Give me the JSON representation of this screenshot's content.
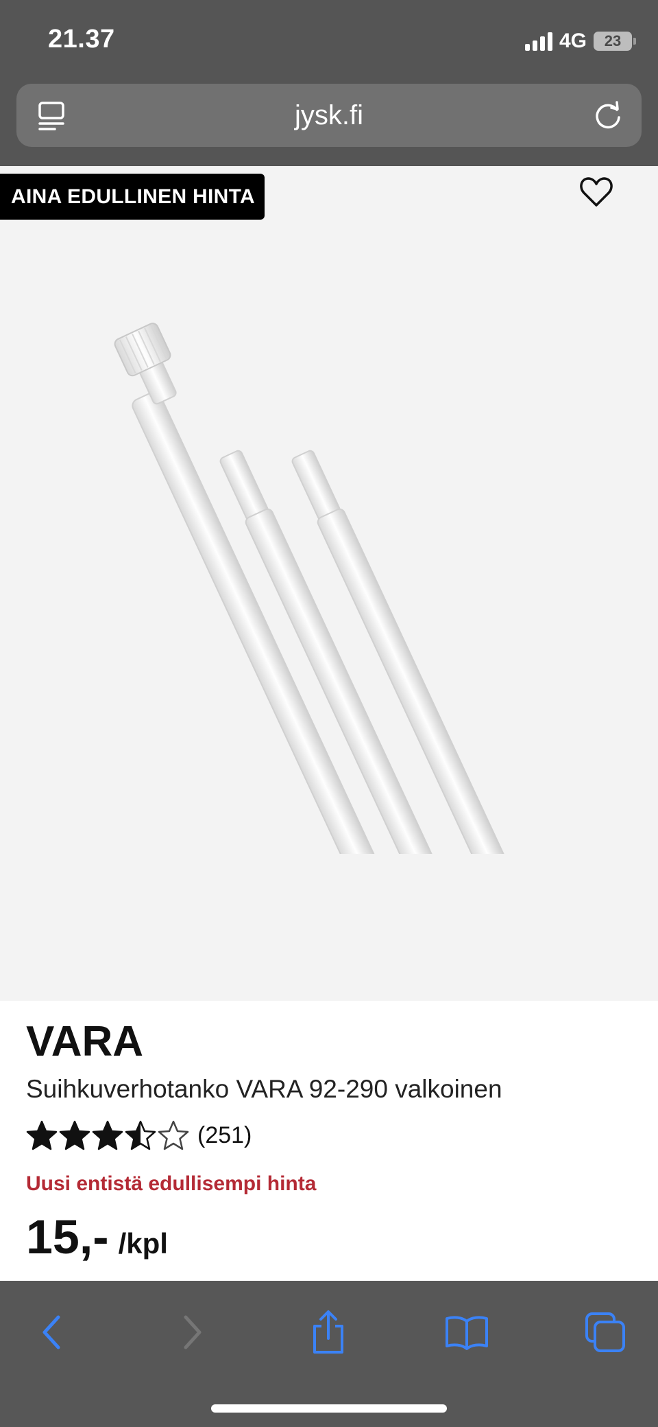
{
  "status_bar": {
    "time": "21.37",
    "network": "4G",
    "battery": "23"
  },
  "browser": {
    "url": "jysk.fi"
  },
  "product": {
    "badge": "AINA EDULLINEN HINTA",
    "name": "VARA",
    "description": "Suihkuverhotanko VARA 92-290 valkoinen",
    "rating": 3.5,
    "rating_max": 5,
    "review_count": "(251)",
    "price_note": "Uusi entistä edullisempi hinta",
    "price": "15,-",
    "price_unit": "/kpl"
  },
  "icons": {
    "reader": "reader-mode-icon",
    "reload": "reload-icon",
    "favorite": "heart-icon",
    "back": "chevron-left-icon",
    "forward": "chevron-right-icon",
    "share": "share-icon",
    "bookmarks": "book-icon",
    "tabs": "tabs-icon"
  },
  "colors": {
    "browser_chrome": "#555555",
    "accent_blue": "#3b82f6",
    "price_note": "#b42a35"
  }
}
